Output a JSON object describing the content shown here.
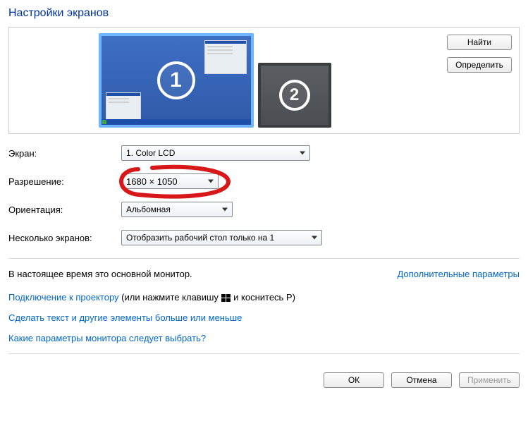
{
  "title": "Настройки экранов",
  "preview": {
    "find_label": "Найти",
    "identify_label": "Определить",
    "monitor1_num": "1",
    "monitor2_num": "2"
  },
  "settings": {
    "screen_label": "Экран:",
    "screen_value": "1. Color LCD",
    "resolution_label": "Разрешение:",
    "resolution_value": "1680 × 1050",
    "orientation_label": "Ориентация:",
    "orientation_value": "Альбомная",
    "multi_label": "Несколько экранов:",
    "multi_value": "Отобразить рабочий стол только на 1"
  },
  "info": {
    "primary_text": "В настоящее время это основной монитор.",
    "advanced_link": "Дополнительные параметры"
  },
  "links": {
    "projector_prefix": "Подключение к проектору",
    "projector_suffix_a": " (или нажмите клавишу ",
    "projector_suffix_b": " и коснитесь P)",
    "textsize": "Сделать текст и другие элементы больше или меньше",
    "help": "Какие параметры монитора следует выбрать?"
  },
  "footer": {
    "ok": "ОК",
    "cancel": "Отмена",
    "apply": "Применить"
  }
}
